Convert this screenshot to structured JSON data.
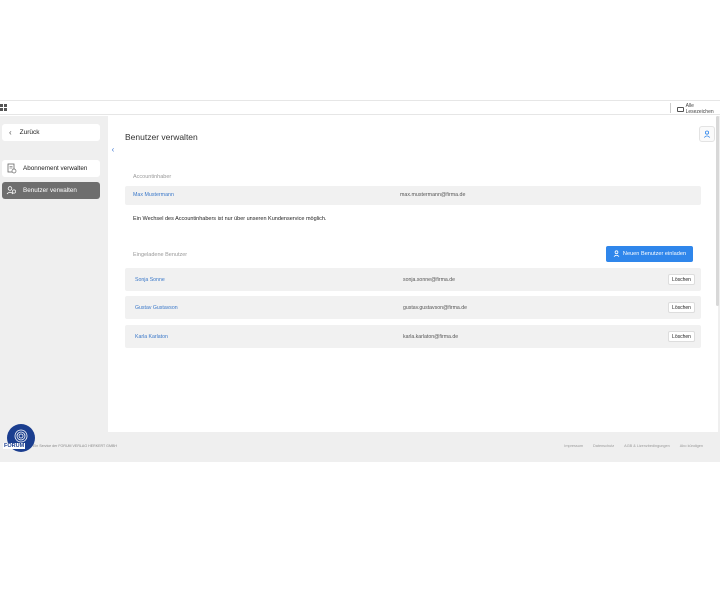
{
  "browser": {
    "bookmarks_all": "Alle Lesezeichen"
  },
  "sidebar": {
    "back_label": "Zurück",
    "items": [
      {
        "label": "Abonnement verwalten",
        "icon": "document-icon",
        "active": false
      },
      {
        "label": "Benutzer verwalten",
        "icon": "users-icon",
        "active": true
      }
    ]
  },
  "main": {
    "title": "Benutzer verwalten",
    "owner_section_label": "Accountinhaber",
    "owner": {
      "name": "Max Mustermann",
      "email": "max.mustermann@firma.de"
    },
    "owner_note": "Ein Wechsel des Accountinhabers ist nur über unseren Kundenservice möglich.",
    "invited_section_label": "Eingeladene Benutzer",
    "invite_button_label": "Neuen Benutzer einladen",
    "invited_users": [
      {
        "name": "Sonja Sonne",
        "email": "sonja.sonne@firma.de",
        "delete_label": "Löschen"
      },
      {
        "name": "Gustav Gustavson",
        "email": "gustav.gustavson@firma.de",
        "delete_label": "Löschen"
      },
      {
        "name": "Karla Karlaton",
        "email": "karla.karlaton@firma.de",
        "delete_label": "Löschen"
      }
    ]
  },
  "footer": {
    "left_text": "Ein Service der FORUM VERLAG HERKERT GMBH",
    "links": [
      "Impressum",
      "Datenschutz",
      "AGB & Lizenzbedingungen",
      "Abo kündigen"
    ]
  },
  "logo": {
    "text": "FORUM"
  },
  "colors": {
    "accent": "#2f86eb",
    "link": "#3a78c9",
    "active_sidebar": "#6e6e6e",
    "logo": "#1b3e8f"
  }
}
